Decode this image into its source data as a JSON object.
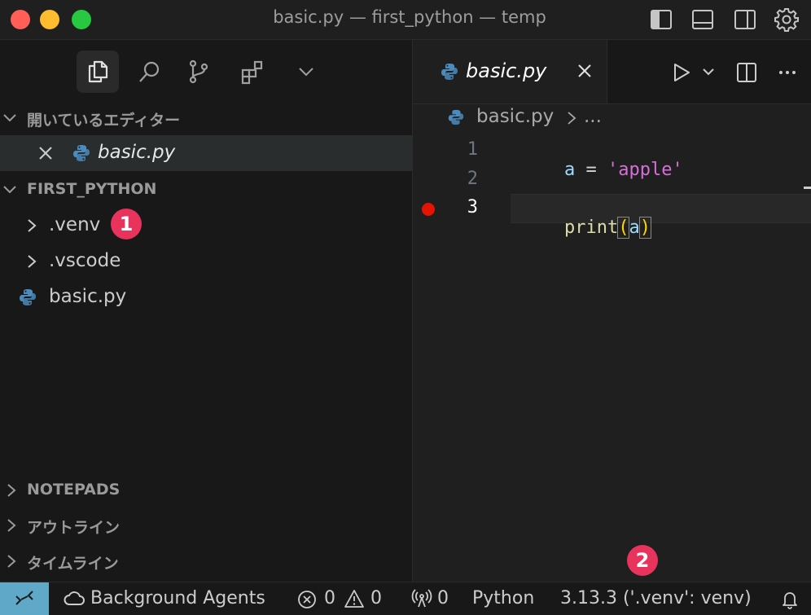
{
  "window": {
    "title": "basic.py — first_python — temp"
  },
  "activity_bar": {
    "icons": [
      "files-icon",
      "search-icon",
      "source-control-icon",
      "extensions-icon",
      "chevron-down-icon"
    ]
  },
  "sidebar": {
    "open_editors": {
      "header": "開いているエディター",
      "items": [
        {
          "label": "basic.py"
        }
      ]
    },
    "explorer": {
      "header": "FIRST_PYTHON",
      "items": [
        {
          "label": ".venv",
          "kind": "folder"
        },
        {
          "label": ".vscode",
          "kind": "folder"
        },
        {
          "label": "basic.py",
          "kind": "python-file"
        }
      ]
    },
    "collapsed_sections": [
      {
        "label": "NOTEPADS"
      },
      {
        "label": "アウトライン"
      },
      {
        "label": "タイムライン"
      }
    ]
  },
  "editor": {
    "tab_label": "basic.py",
    "breadcrumb": {
      "file": "basic.py",
      "more": "..."
    },
    "lines": [
      {
        "number": "1",
        "tokens": [
          {
            "text": "a",
            "color": "#9cdcfe"
          },
          {
            "text": " = ",
            "color": "#d4d4d4"
          },
          {
            "text": "'apple'",
            "color": "#d670d6"
          }
        ]
      },
      {
        "number": "2",
        "tokens": []
      },
      {
        "number": "3",
        "tokens": [
          {
            "text": "print",
            "color": "#dcdcaa"
          },
          {
            "text": "(",
            "color": "#ffd700"
          },
          {
            "text": "a",
            "color": "#9cdcfe"
          },
          {
            "text": ")",
            "color": "#ffd700"
          }
        ]
      }
    ],
    "breakpoint_line": "3"
  },
  "annotations": {
    "badge_1": "1",
    "badge_2": "2",
    "badge_color": "#e8335d"
  },
  "statusbar": {
    "background_agents": "Background Agents",
    "errors": "0",
    "warnings": "0",
    "ports": "0",
    "language": "Python",
    "interpreter": "3.13.3 ('.venv': venv)"
  },
  "colors": {
    "remote_button": "#5fa8c7",
    "python_icon": "#4b8bbe",
    "breakpoint": "#e51400"
  }
}
